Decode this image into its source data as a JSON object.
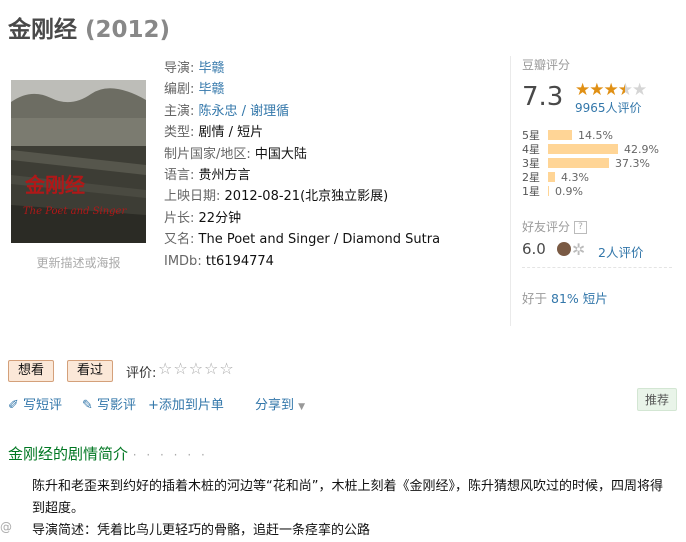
{
  "movie": {
    "title": "金刚经",
    "year": "(2012)"
  },
  "poster": {
    "caption": "更新描述或海报",
    "title_cn": "金刚经",
    "title_en": "The Poet and Singer"
  },
  "info": [
    {
      "key": "导演:",
      "value": "毕赣",
      "link": true
    },
    {
      "key": "编剧:",
      "value": "毕赣",
      "link": true
    },
    {
      "key": "主演:",
      "value": "陈永忠 / 谢理循",
      "link": true
    },
    {
      "key": "类型:",
      "value": "剧情 / 短片",
      "link": false
    },
    {
      "key": "制片国家/地区:",
      "value": "中国大陆",
      "link": false
    },
    {
      "key": "语言:",
      "value": "贵州方言",
      "link": false
    },
    {
      "key": "上映日期:",
      "value": "2012-08-21(北京独立影展)",
      "link": false
    },
    {
      "key": "片长:",
      "value": "22分钟",
      "link": false
    },
    {
      "key": "又名:",
      "value": "The Poet and Singer / Diamond Sutra",
      "link": false
    },
    {
      "key": "IMDb:",
      "value": "tt6194774",
      "link": false
    }
  ],
  "rating": {
    "label": "豆瓣评分",
    "score": "7.3",
    "count": "9965人评价",
    "stars": 3.5,
    "histogram": [
      {
        "label": "5星",
        "pct": "14.5%",
        "value": 14.5
      },
      {
        "label": "4星",
        "pct": "42.9%",
        "value": 42.9
      },
      {
        "label": "3星",
        "pct": "37.3%",
        "value": 37.3
      },
      {
        "label": "2星",
        "pct": "4.3%",
        "value": 4.3
      },
      {
        "label": "1星",
        "pct": "0.9%",
        "value": 0.9
      }
    ],
    "bar_color": "#ffd596",
    "star_color": "#e09015"
  },
  "friends": {
    "label": "好友评分",
    "help": "?",
    "score": "6.0",
    "count": "2人评价"
  },
  "better_than": {
    "prefix": "好于",
    "value": "81% 短片"
  },
  "buttons": {
    "want": "想看",
    "seen": "看过"
  },
  "my_rating": {
    "label": "评价:",
    "stars": "☆☆☆☆☆"
  },
  "actions": {
    "write_short": "写短评",
    "write_review": "写影评",
    "add_list": "+添加到片单",
    "share": "分享到",
    "recommend": "推荐"
  },
  "section": {
    "title": "金刚经的剧情简介",
    "dots": "· · · · · ·"
  },
  "plot": {
    "line1": "陈升和老歪来到约好的插着木桩的河边等“花和尚”，木桩上刻着《金刚经》，陈升猜想风吹过的时候，四周将得到超度。",
    "line2": "导演简述：凭着比鸟儿更轻巧的骨骼，追赶一条痉挛的公路"
  },
  "watermark": "@"
}
